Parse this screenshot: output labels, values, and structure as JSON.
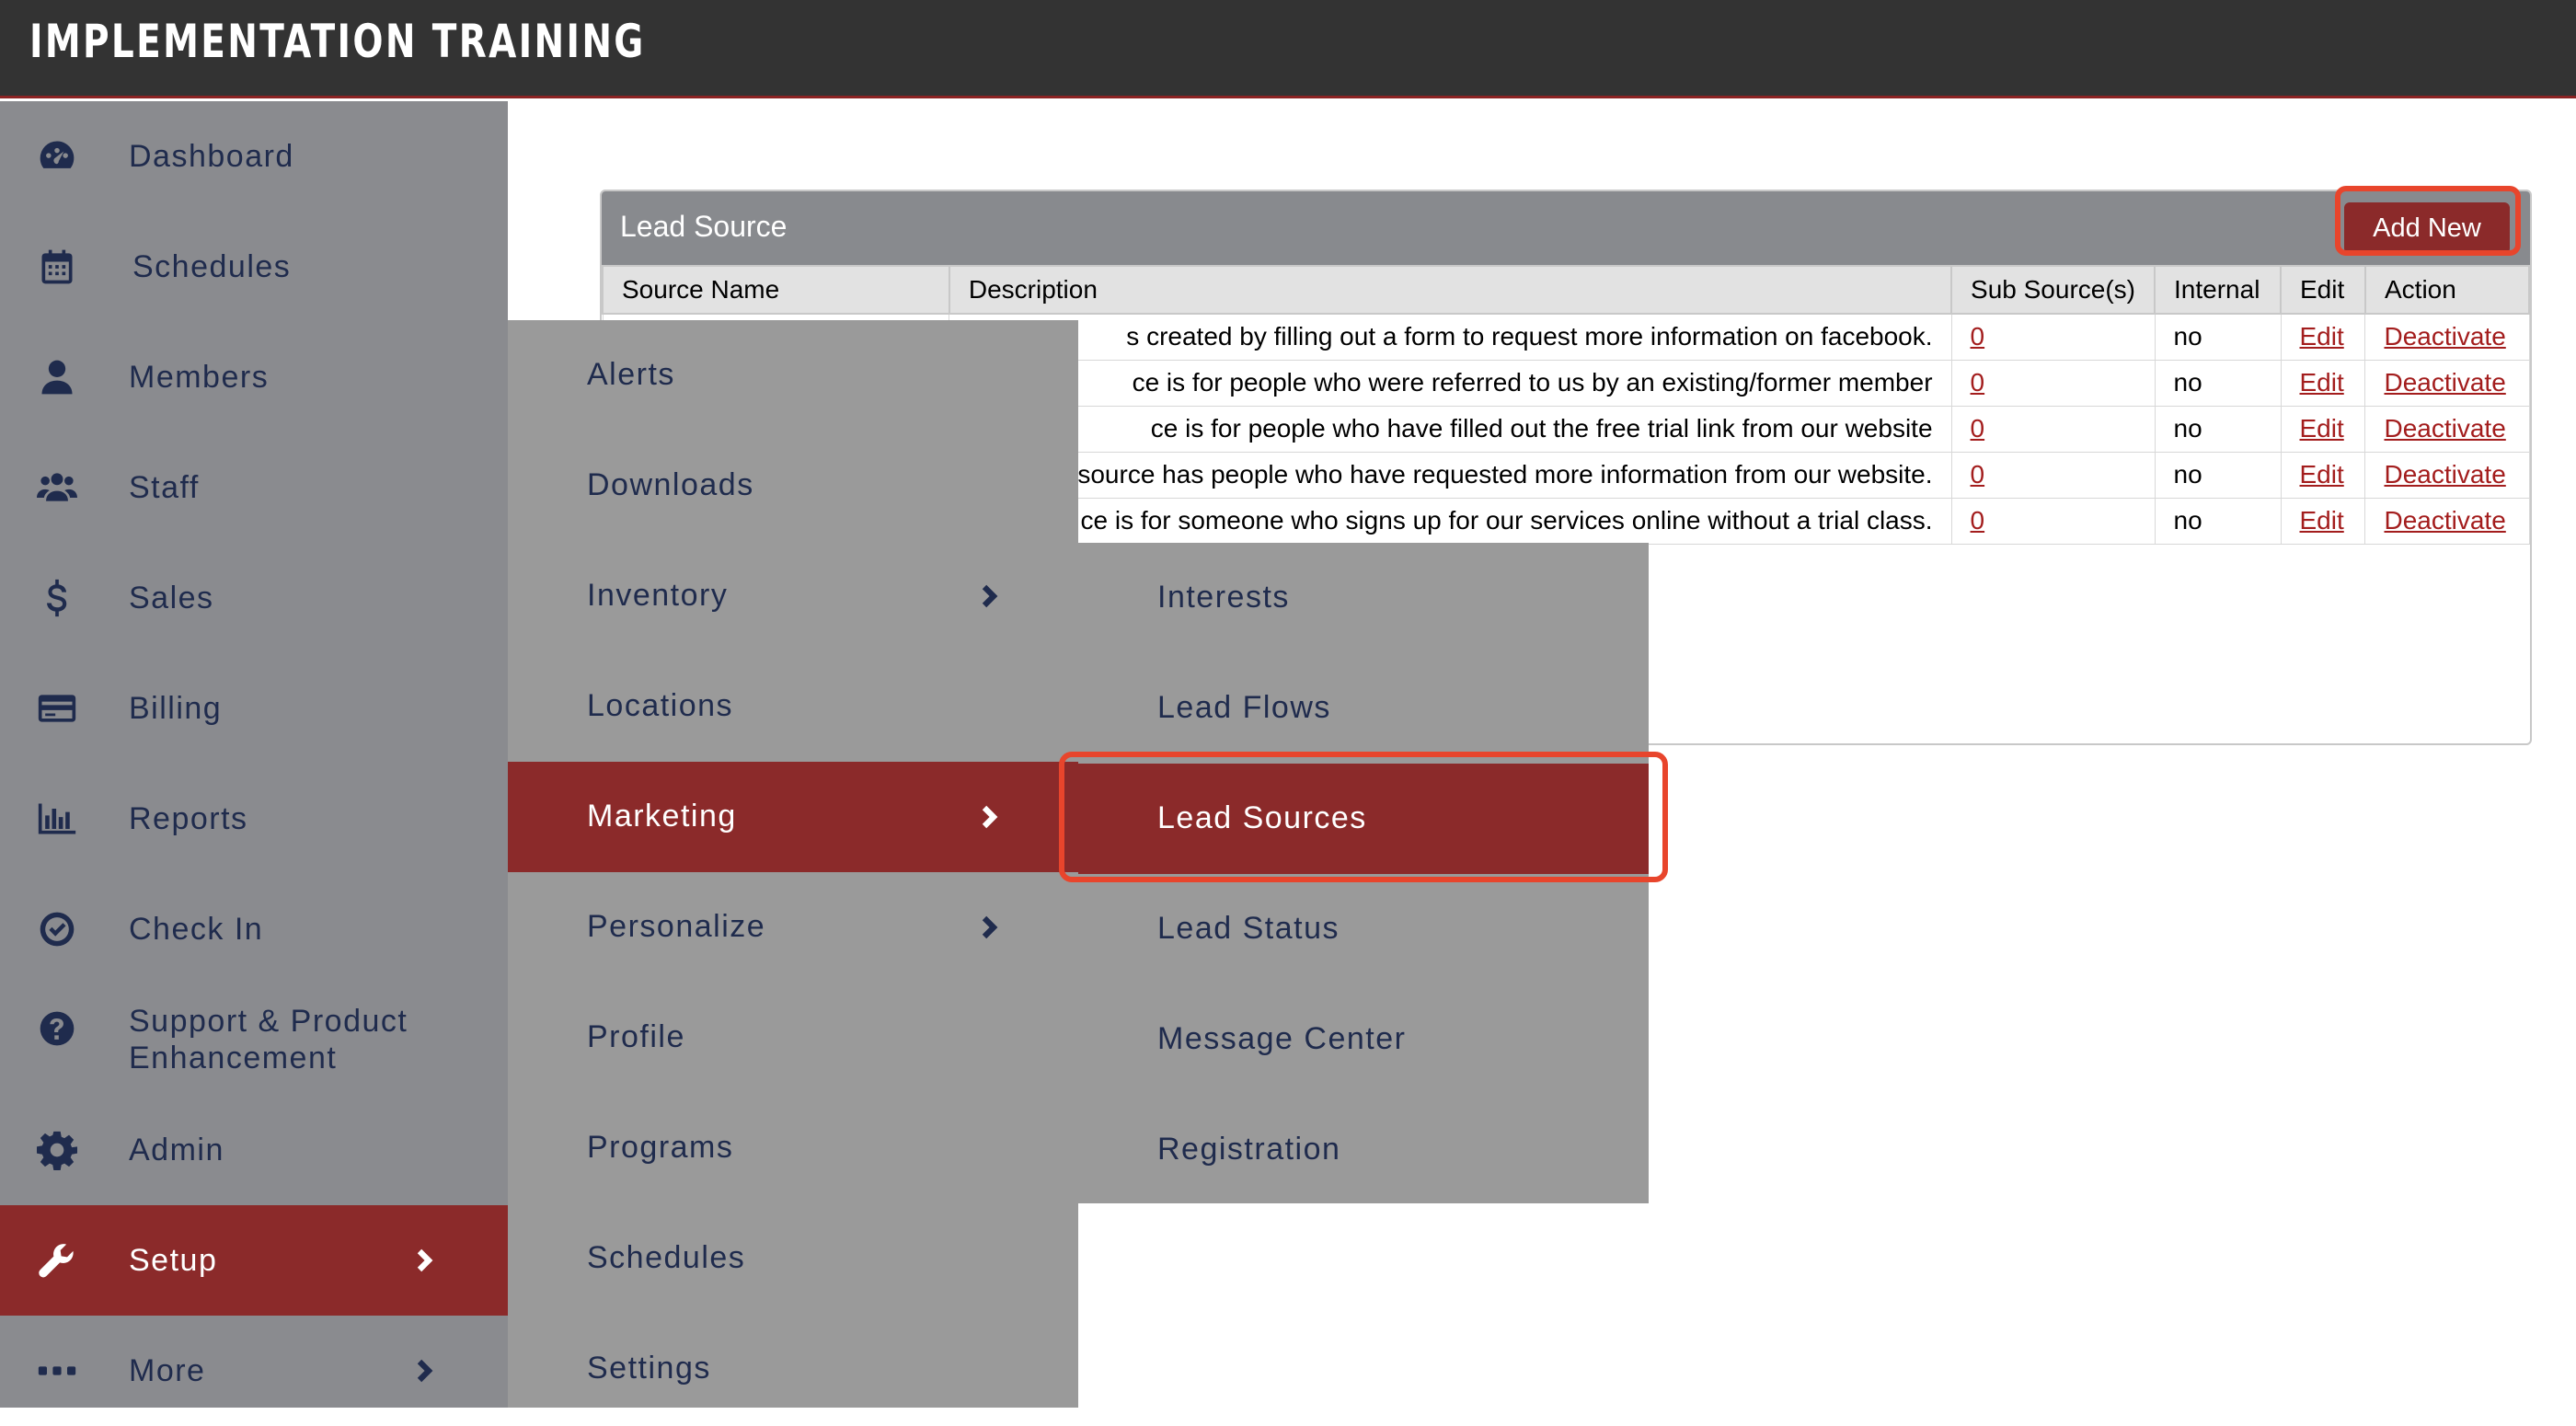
{
  "app": {
    "title": "IMPLEMENTATION TRAINING"
  },
  "sidebar": {
    "items": [
      {
        "label": "Dashboard",
        "icon": "dashboard-icon"
      },
      {
        "label": "Schedules",
        "icon": "calendar-icon"
      },
      {
        "label": "Members",
        "icon": "user-icon"
      },
      {
        "label": "Staff",
        "icon": "users-icon"
      },
      {
        "label": "Sales",
        "icon": "dollar-icon"
      },
      {
        "label": "Billing",
        "icon": "credit-card-icon"
      },
      {
        "label": "Reports",
        "icon": "bar-chart-icon"
      },
      {
        "label": "Check In",
        "icon": "check-circle-icon"
      },
      {
        "label": "Support & Product Enhancement",
        "icon": "question-circle-icon"
      },
      {
        "label": "Admin",
        "icon": "gear-icon"
      },
      {
        "label": "Setup",
        "icon": "wrench-icon",
        "active": true
      },
      {
        "label": "More",
        "icon": "ellipsis-icon"
      }
    ]
  },
  "card": {
    "title": "Lead Source",
    "add_label": "Add New",
    "columns": [
      "Source Name",
      "Description",
      "Sub Source(s)",
      "Internal",
      "Edit",
      "Action"
    ],
    "rows": [
      {
        "source_name": "",
        "description": "s created by filling out a form to request more information on facebook.",
        "sub_sources": "0",
        "internal": "no",
        "edit": "Edit",
        "action": "Deactivate"
      },
      {
        "source_name": "",
        "description": "ce is for people who were referred to us by an existing/former member",
        "sub_sources": "0",
        "internal": "no",
        "edit": "Edit",
        "action": "Deactivate"
      },
      {
        "source_name": "",
        "description": "ce is for people who have filled out the free trial link from our website",
        "sub_sources": "0",
        "internal": "no",
        "edit": "Edit",
        "action": "Deactivate"
      },
      {
        "source_name": "",
        "description": "source has people who have requested more information from our website.",
        "sub_sources": "0",
        "internal": "no",
        "edit": "Edit",
        "action": "Deactivate"
      },
      {
        "source_name": "",
        "description": "ce is for someone who signs up for our services online without a trial class.",
        "sub_sources": "0",
        "internal": "no",
        "edit": "Edit",
        "action": "Deactivate"
      }
    ]
  },
  "setup_menu": {
    "items": [
      {
        "label": "Alerts"
      },
      {
        "label": "Downloads"
      },
      {
        "label": "Inventory",
        "has_submenu": true
      },
      {
        "label": "Locations"
      },
      {
        "label": "Marketing",
        "has_submenu": true,
        "active": true
      },
      {
        "label": "Personalize",
        "has_submenu": true
      },
      {
        "label": "Profile"
      },
      {
        "label": "Programs"
      },
      {
        "label": "Schedules"
      },
      {
        "label": "Settings"
      }
    ]
  },
  "marketing_menu": {
    "items": [
      {
        "label": "Interests"
      },
      {
        "label": "Lead Flows"
      },
      {
        "label": "Lead Sources",
        "active": true
      },
      {
        "label": "Lead Status"
      },
      {
        "label": "Message Center"
      },
      {
        "label": "Registration"
      }
    ]
  },
  "colors": {
    "accent": "#8b2a2a",
    "highlight": "#e8452c",
    "sidebar": "#8a8b8f",
    "topbar": "#333333"
  }
}
